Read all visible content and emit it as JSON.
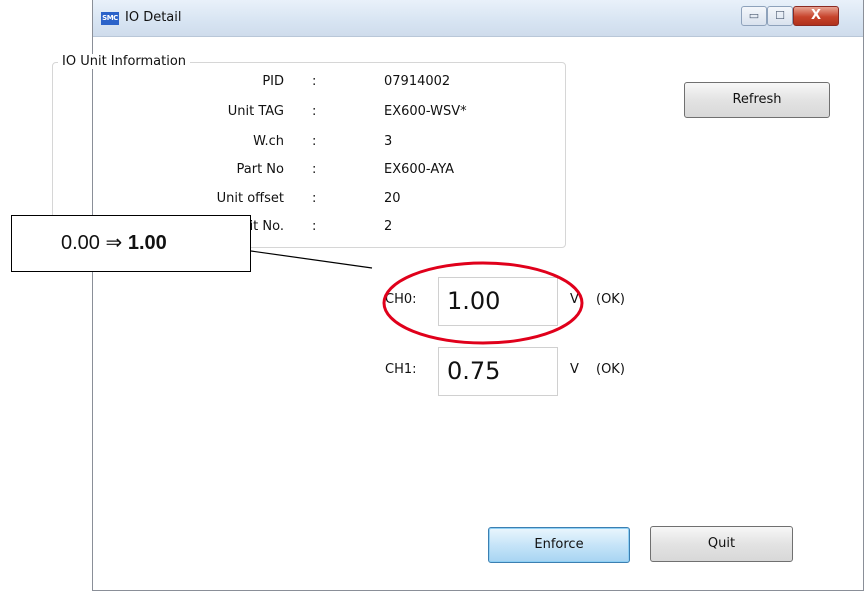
{
  "window": {
    "title": "IO Detail",
    "app_icon_text": "SMC",
    "controls": {
      "minimize": "▭",
      "maximize": "☐",
      "close": "X"
    }
  },
  "info": {
    "group_title": "IO Unit Information",
    "rows": [
      {
        "label": "PID",
        "value": "07914002"
      },
      {
        "label": "Unit TAG",
        "value": "EX600-WSV*"
      },
      {
        "label": "W.ch",
        "value": "3"
      },
      {
        "label": "Part No",
        "value": "EX600-AYA"
      },
      {
        "label": "Unit offset",
        "value": "20"
      },
      {
        "label": "Unit No.",
        "value": "2"
      }
    ],
    "separator": ":"
  },
  "channels": [
    {
      "label": "CH0:",
      "value": "1.00",
      "unit": "V",
      "status": "(OK)"
    },
    {
      "label": "CH1:",
      "value": "0.75",
      "unit": "V",
      "status": "(OK)"
    }
  ],
  "buttons": {
    "refresh": "Refresh",
    "enforce": "Enforce",
    "quit": "Quit"
  },
  "annotation": {
    "old_value": "0.00",
    "arrow": "⇒",
    "new_value": "1.00",
    "color": "#e0001b"
  }
}
